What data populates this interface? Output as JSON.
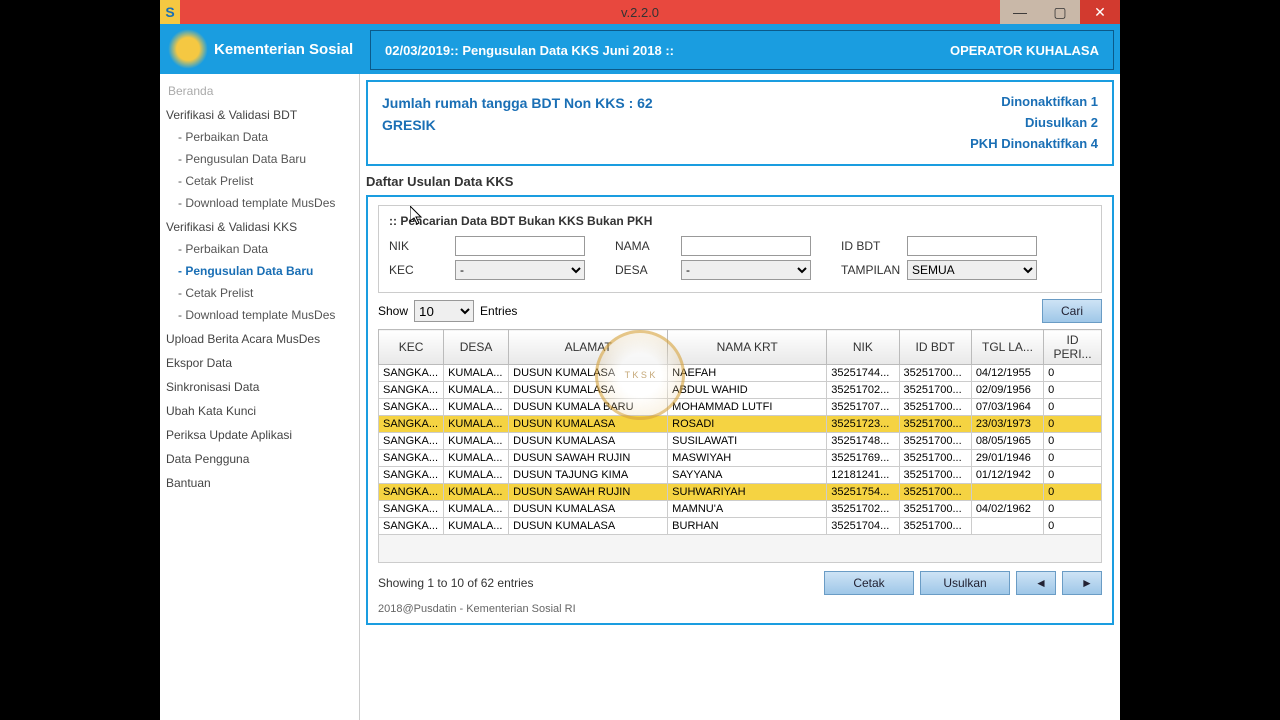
{
  "window": {
    "title": "v.2.2.0"
  },
  "logo_text": "Kementerian Sosial",
  "topbar": {
    "left": "02/03/2019:: Pengusulan Data KKS Juni 2018 ::",
    "right": "OPERATOR KUHALASA"
  },
  "sidebar": {
    "root": "Beranda",
    "s1": "Verifikasi & Validasi BDT",
    "s1_items": [
      "- Perbaikan Data",
      "- Pengusulan Data Baru",
      "- Cetak Prelist",
      "- Download template MusDes"
    ],
    "s2": "Verifikasi & Validasi KKS",
    "s2_items": [
      "- Perbaikan Data",
      "- Pengusulan Data Baru",
      "- Cetak Prelist",
      "- Download template MusDes"
    ],
    "rest": [
      "Upload Berita Acara MusDes",
      "Ekspor Data",
      "Sinkronisasi Data",
      "Ubah Kata Kunci",
      "Periksa Update Aplikasi",
      "Data Pengguna",
      "Bantuan"
    ]
  },
  "summary": {
    "line1": "Jumlah rumah tangga BDT Non KKS : 62",
    "line2": "GRESIK",
    "r1": "Dinonaktifkan 1",
    "r2": "Diusulkan 2",
    "r3": "PKH Dinonaktifkan 4"
  },
  "list_title": "Daftar Usulan Data KKS",
  "search": {
    "title": ":: Pencarian Data BDT Bukan KKS Bukan PKH",
    "nik": "NIK",
    "nama": "NAMA",
    "idbdt": "ID BDT",
    "kec": "KEC",
    "desa": "DESA",
    "tampilan": "TAMPILAN",
    "kec_opt": "-",
    "desa_opt": "-",
    "tampilan_opt": "SEMUA"
  },
  "toolbar": {
    "show": "Show",
    "show_val": "10",
    "entries": "Entries",
    "cari": "Cari"
  },
  "columns": [
    "KEC",
    "DESA",
    "ALAMAT",
    "NAMA KRT",
    "NIK",
    "ID BDT",
    "TGL LA...",
    "ID PERI..."
  ],
  "rows": [
    {
      "hl": false,
      "c": [
        "SANGKA...",
        "KUMALA...",
        "DUSUN KUMALASA",
        "NAEFAH",
        "35251744...",
        "35251700...",
        "04/12/1955",
        "0"
      ]
    },
    {
      "hl": false,
      "c": [
        "SANGKA...",
        "KUMALA...",
        "DUSUN KUMALASA",
        "ABDUL WAHID",
        "35251702...",
        "35251700...",
        "02/09/1956",
        "0"
      ]
    },
    {
      "hl": false,
      "c": [
        "SANGKA...",
        "KUMALA...",
        "DUSUN KUMALA BARU",
        "MOHAMMAD LUTFI",
        "35251707...",
        "35251700...",
        "07/03/1964",
        "0"
      ]
    },
    {
      "hl": true,
      "c": [
        "SANGKA...",
        "KUMALA...",
        "DUSUN KUMALASA",
        "ROSADI",
        "35251723...",
        "35251700...",
        "23/03/1973",
        "0"
      ]
    },
    {
      "hl": false,
      "c": [
        "SANGKA...",
        "KUMALA...",
        "DUSUN KUMALASA",
        "SUSILAWATI",
        "35251748...",
        "35251700...",
        "08/05/1965",
        "0"
      ]
    },
    {
      "hl": false,
      "c": [
        "SANGKA...",
        "KUMALA...",
        "DUSUN SAWAH RUJIN",
        "MASWIYAH",
        "35251769...",
        "35251700...",
        "29/01/1946",
        "0"
      ]
    },
    {
      "hl": false,
      "c": [
        "SANGKA...",
        "KUMALA...",
        "DUSUN TAJUNG KIMA",
        "SAYYANA",
        "12181241...",
        "35251700...",
        "01/12/1942",
        "0"
      ]
    },
    {
      "hl": true,
      "c": [
        "SANGKA...",
        "KUMALA...",
        "DUSUN SAWAH RUJIN",
        "SUHWARIYAH",
        "35251754...",
        "35251700...",
        "",
        "0"
      ]
    },
    {
      "hl": false,
      "c": [
        "SANGKA...",
        "KUMALA...",
        "DUSUN KUMALASA",
        "MAMNU'A",
        "35251702...",
        "35251700...",
        "04/02/1962",
        "0"
      ]
    },
    {
      "hl": false,
      "c": [
        "SANGKA...",
        "KUMALA...",
        "DUSUN KUMALASA",
        "BURHAN",
        "35251704...",
        "35251700...",
        "",
        "0"
      ]
    }
  ],
  "pager": {
    "info": "Showing 1 to 10 of 62 entries",
    "cetak": "Cetak",
    "usulkan": "Usulkan"
  },
  "footer": "2018@Pusdatin - Kementerian Sosial RI"
}
